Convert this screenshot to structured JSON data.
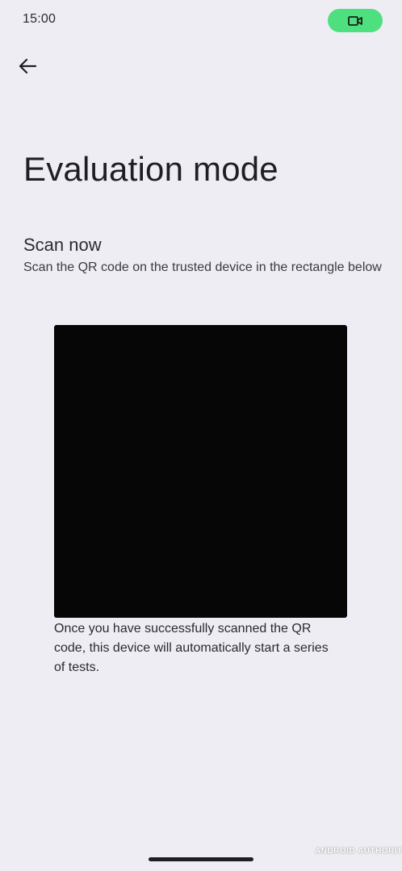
{
  "status_bar": {
    "time": "15:00",
    "recording_icon": "video-camera-icon",
    "recording_color": "#4ee07f"
  },
  "toolbar": {
    "back_icon": "arrow-back-icon"
  },
  "page": {
    "title": "Evaluation mode"
  },
  "scan": {
    "heading": "Scan now",
    "description": "Scan the QR code on the trusted device in the rectangle below",
    "footer": "Once you have successfully scanned the QR code, this device will automatically start a series of tests."
  },
  "watermark": {
    "text": "ANDROID AUTHORITY"
  },
  "colors": {
    "background": "#efedf4",
    "viewfinder": "#060606",
    "text": "#1f1f23"
  }
}
